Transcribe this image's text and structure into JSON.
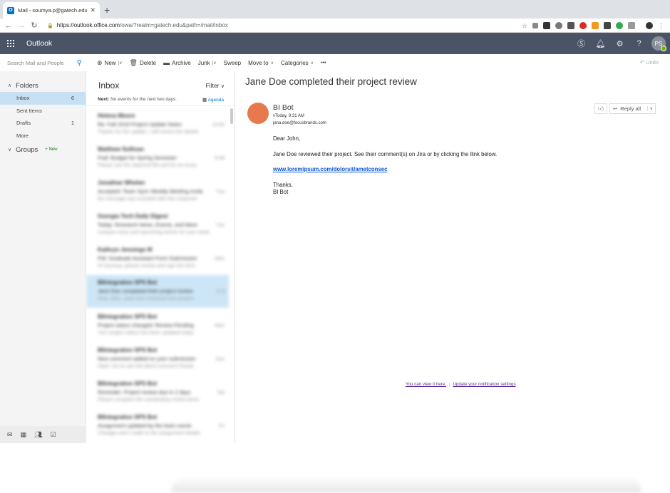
{
  "browser": {
    "tab_title": "Mail - soumya.p@gatech.edu",
    "tab_favicon": "O",
    "new_tab": "+",
    "url_host": "https://outlook.office.com",
    "url_path": "/owa/?realm=gatech.edu&path=/mail/inbox"
  },
  "header": {
    "app_name": "Outlook",
    "avatar_initials": "PS"
  },
  "search": {
    "placeholder": "Search Mail and People"
  },
  "commands": {
    "new": "New",
    "delete": "Delete",
    "archive": "Archive",
    "junk": "Junk",
    "sweep": "Sweep",
    "move_to": "Move to",
    "categories": "Categories",
    "more": "•••",
    "undo": "Undo"
  },
  "folders": {
    "heading": "Folders",
    "items": [
      {
        "label": "Inbox",
        "count": "6"
      },
      {
        "label": "Sent Items",
        "count": ""
      },
      {
        "label": "Drafts",
        "count": "1"
      },
      {
        "label": "More",
        "count": ""
      }
    ],
    "groups_heading": "Groups",
    "groups_badge": "+ New"
  },
  "message_list": {
    "title": "Inbox",
    "filter": "Filter",
    "next_label": "Next:",
    "next_text": "No events for the next two days.",
    "agenda": "Agenda",
    "messages": [
      {
        "from": "Helena Moore",
        "subject": "Re: Fall 2019 Project Update Notes",
        "preview": "Thanks for the update, I will review the details",
        "time": "10:00"
      },
      {
        "from": "Matthew Sullivan",
        "subject": "Fwd: Budget for Spring Semester",
        "preview": "Please see the attached file and let me know",
        "time": "9:48"
      },
      {
        "from": "Jonathan Whelan",
        "subject": "Accepted: Team Sync Weekly Meeting Invite",
        "preview": "No message was included with this response",
        "time": "Tue"
      },
      {
        "from": "Georgia Tech Daily Digest",
        "subject": "Today: Research News, Events, and More",
        "preview": "Campus news and upcoming events for your week",
        "time": "Tue"
      },
      {
        "from": "Kathryn Jennings M",
        "subject": "FW: Graduate Assistant Form Submission",
        "preview": "Hi Soumya, please review and sign the form",
        "time": "Mon"
      },
      {
        "from": "BIIntegration SPS Bot",
        "subject": "Jane Doe completed their project review",
        "preview": "Dear John, Jane Doe reviewed their project",
        "time": "9:31"
      },
      {
        "from": "BIIntegration SPS Bot",
        "subject": "Project status changed: Review Pending",
        "preview": "Your project status has been updated today",
        "time": "Mon"
      },
      {
        "from": "BIIntegration SPS Bot",
        "subject": "New comment added on your submission",
        "preview": "Open Jira to see the latest comment thread",
        "time": "Sun"
      },
      {
        "from": "BIIntegration SPS Bot",
        "subject": "Reminder: Project review due in 2 days",
        "preview": "Please complete the outstanding review items",
        "time": "Sat"
      },
      {
        "from": "BIIntegration SPS Bot",
        "subject": "Assignment updated by the team owner",
        "preview": "Changes were made to the assignment details",
        "time": "Fri"
      }
    ]
  },
  "email": {
    "subject": "Jane Doe completed their project review",
    "sender_name": "BI Bot",
    "sent_time": "vToday, 9:31 AM",
    "sender_email": "jana.doe@focusbrands.com",
    "reply_all": "Reply all",
    "greeting": "Dear John,",
    "body": "Jane Doe reviewed their project. See their comment(s) on Jira or by clicking the llink below.",
    "link": "www.loremipsum.com/dolorsit/ametconsec",
    "signoff_1": "Thanks,",
    "signoff_2": "BI Bot",
    "footer_link_1": "You can view it here.",
    "footer_link_2": "Update your notification settings"
  },
  "colors": {
    "header_bg": "#4b5467",
    "selected_folder": "#c7e0f4",
    "sender_avatar": "#e8784e",
    "link": "#0b57d0",
    "footer_link": "#5c2d91"
  }
}
